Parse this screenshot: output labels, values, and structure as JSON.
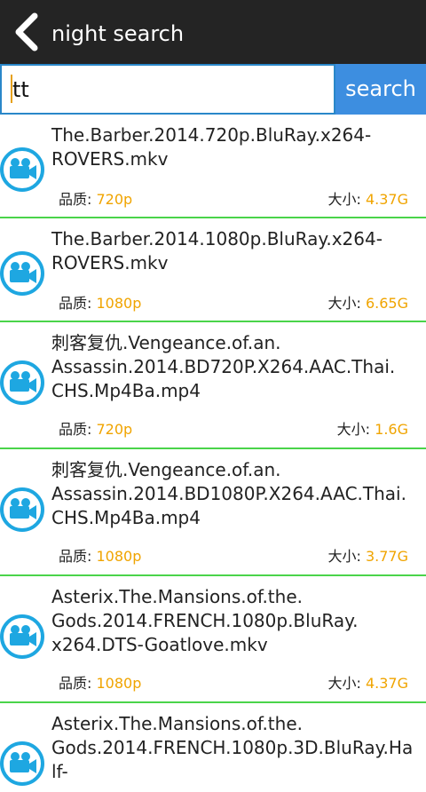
{
  "header": {
    "title": "night search"
  },
  "search": {
    "value": "tt",
    "button_label": "search"
  },
  "labels": {
    "quality": "品质:",
    "size": "大小:"
  },
  "colors": {
    "accent_orange": "#f0a400",
    "divider_green": "#4ad44a",
    "search_blue": "#3d8ee0",
    "icon_blue": "#1ea7e1"
  },
  "results": [
    {
      "name": "The.Barber.2014.720p.BluRay.x264-\nROVERS.mkv",
      "quality": "720p",
      "size": "4.37G",
      "icon": "video-camera-icon"
    },
    {
      "name": "The.Barber.2014.1080p.BluRay.x264-\nROVERS.mkv",
      "quality": "1080p",
      "size": "6.65G",
      "icon": "video-camera-icon"
    },
    {
      "name": "刺客复仇.Vengeance.of.an.\nAssassin.2014.BD720P.X264.AAC.Thai.\nCHS.Mp4Ba.mp4",
      "quality": "720p",
      "size": "1.6G",
      "icon": "video-camera-icon"
    },
    {
      "name": "刺客复仇.Vengeance.of.an.\nAssassin.2014.BD1080P.X264.AAC.Thai.\nCHS.Mp4Ba.mp4",
      "quality": "1080p",
      "size": "3.77G",
      "icon": "video-camera-icon"
    },
    {
      "name": "Asterix.The.Mansions.of.the.\nGods.2014.FRENCH.1080p.BluRay.\nx264.DTS-Goatlove.mkv",
      "quality": "1080p",
      "size": "4.37G",
      "icon": "video-camera-icon"
    },
    {
      "name": "Asterix.The.Mansions.of.the.\nGods.2014.FRENCH.1080p.3D.BluRay.Half-",
      "quality": "",
      "size": "",
      "icon": "video-camera-icon"
    }
  ]
}
